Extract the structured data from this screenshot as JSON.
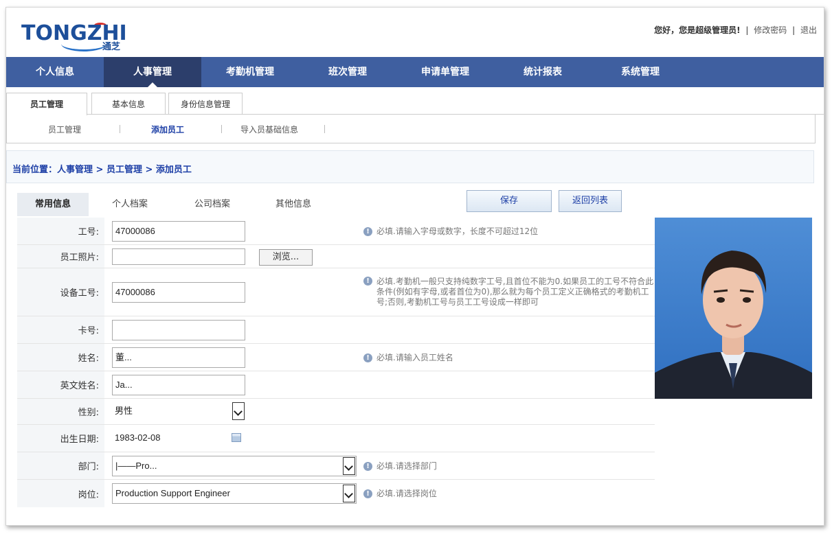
{
  "header": {
    "logo_text": "TONGZHI",
    "logo_sub": "通芝",
    "greeting": "您好，您是超级管理员!",
    "change_password": "修改密码",
    "logout": "退出",
    "sep": "|"
  },
  "mainnav": {
    "items": [
      "个人信息",
      "人事管理",
      "考勤机管理",
      "班次管理",
      "申请单管理",
      "统计报表",
      "系统管理"
    ],
    "active": "人事管理"
  },
  "subtabs": [
    "员工管理",
    "基本信息",
    "身份信息管理"
  ],
  "thirdnav": [
    "员工管理",
    "添加员工",
    "导入员基础信息"
  ],
  "breadcrumb": "当前位置：人事管理 > 员工管理 > 添加员工",
  "formtabs": [
    "常用信息",
    "个人档案",
    "公司档案",
    "其他信息"
  ],
  "buttons": {
    "save": "保存",
    "back": "返回列表"
  },
  "form": {
    "employee_no": {
      "label": "工号:",
      "value": "47000086",
      "hint": "必填.请输入字母或数字，长度不可超过12位"
    },
    "photo": {
      "label": "员工照片:",
      "value": "",
      "browse": "浏览..."
    },
    "device_no": {
      "label": "设备工号:",
      "value": "47000086",
      "hint": "必填.考勤机一般只支持纯数字工号,且首位不能为0.如果员工的工号不符合此条件(例如有字母,或者首位为0),那么就为每个员工定义正确格式的考勤机工号;否则,考勤机工号与员工工号设成一样即可"
    },
    "card_no": {
      "label": "卡号:",
      "value": ""
    },
    "name": {
      "label": "姓名:",
      "value": "董...",
      "hint": "必填.请输入员工姓名"
    },
    "english_name": {
      "label": "英文姓名:",
      "value": "Ja..."
    },
    "gender": {
      "label": "性别:",
      "value": "男性"
    },
    "birth_date": {
      "label": "出生日期:",
      "value": "1983-02-08"
    },
    "department": {
      "label": "部门:",
      "value": "|——Pro...",
      "hint": "必填.请选择部门"
    },
    "position": {
      "label": "岗位:",
      "value": "Production Support Engineer",
      "hint": "必填.请选择岗位"
    }
  },
  "hint_icon": "!",
  "colors": {
    "nav_bg": "#3f5fa0",
    "nav_active": "#2c3e6b",
    "link": "#1d3fa6"
  }
}
